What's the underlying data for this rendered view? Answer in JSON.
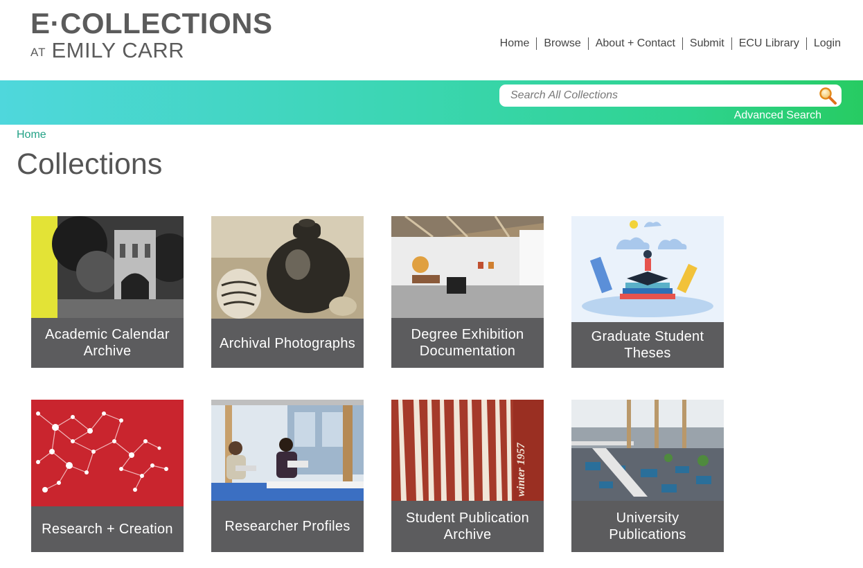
{
  "header": {
    "logo_main": "E·COLLECTIONS",
    "logo_at": "AT",
    "logo_name": "EMILY CARR",
    "nav": [
      "Home",
      "Browse",
      "About + Contact",
      "Submit",
      "ECU Library",
      "Login"
    ]
  },
  "search": {
    "placeholder": "Search All Collections",
    "value": "",
    "advanced_label": "Advanced Search",
    "icon": "magnifier-icon"
  },
  "breadcrumb": {
    "home": "Home"
  },
  "page": {
    "title": "Collections"
  },
  "collections": [
    {
      "label": "Academic Calendar Archive"
    },
    {
      "label": "Archival Photographs"
    },
    {
      "label": "Degree Exhibition Documentation"
    },
    {
      "label": "Graduate Student Theses"
    },
    {
      "label": "Research + Creation"
    },
    {
      "label": "Researcher Profiles"
    },
    {
      "label": "Student Publication Archive"
    },
    {
      "label": "University Publications"
    }
  ],
  "colors": {
    "card_label_bg": "#5c5c5e",
    "accent_link": "#21a185",
    "band_start": "#4fd7dc",
    "band_end": "#27cb62",
    "research_red": "#c9252e",
    "calendar_yellow": "#e3e336"
  }
}
